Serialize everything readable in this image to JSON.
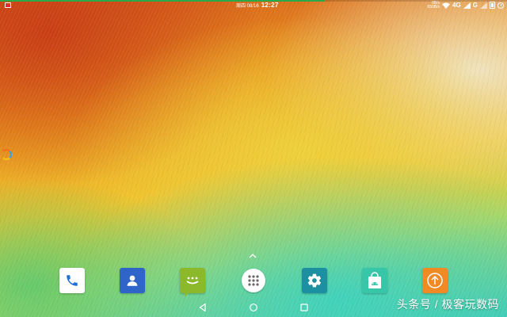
{
  "status_bar": {
    "progress": 0.64,
    "progress_color": "#2aa84a",
    "date": "周四 08/16",
    "time": "12:27",
    "net_speed_up": "0B/s",
    "net_speed_down": "650B/s",
    "network_type": "4G",
    "network_type_2": "G",
    "icons": [
      "notification-icon",
      "wifi-icon",
      "signal-icon",
      "battery-icon",
      "alarm-icon"
    ]
  },
  "dock": {
    "apps": [
      {
        "name": "phone",
        "icon": "phone-icon"
      },
      {
        "name": "contacts",
        "icon": "contacts-icon"
      },
      {
        "name": "messages",
        "icon": "messages-icon"
      },
      {
        "name": "app-launcher",
        "icon": "app-grid-icon"
      },
      {
        "name": "settings",
        "icon": "gear-icon"
      },
      {
        "name": "app-store",
        "icon": "shopping-bag-icon"
      },
      {
        "name": "system-update",
        "icon": "upload-arrow-icon"
      }
    ]
  },
  "navigation": {
    "buttons": [
      "back-icon",
      "home-icon",
      "recents-icon"
    ]
  },
  "watermark": {
    "text": "头条号 / 极客玩数码"
  },
  "colors": {
    "accent_orange": "#f08a24",
    "accent_blue": "#2f64c9",
    "accent_green": "#8cb82b",
    "accent_teal": "#1c8fa0"
  }
}
